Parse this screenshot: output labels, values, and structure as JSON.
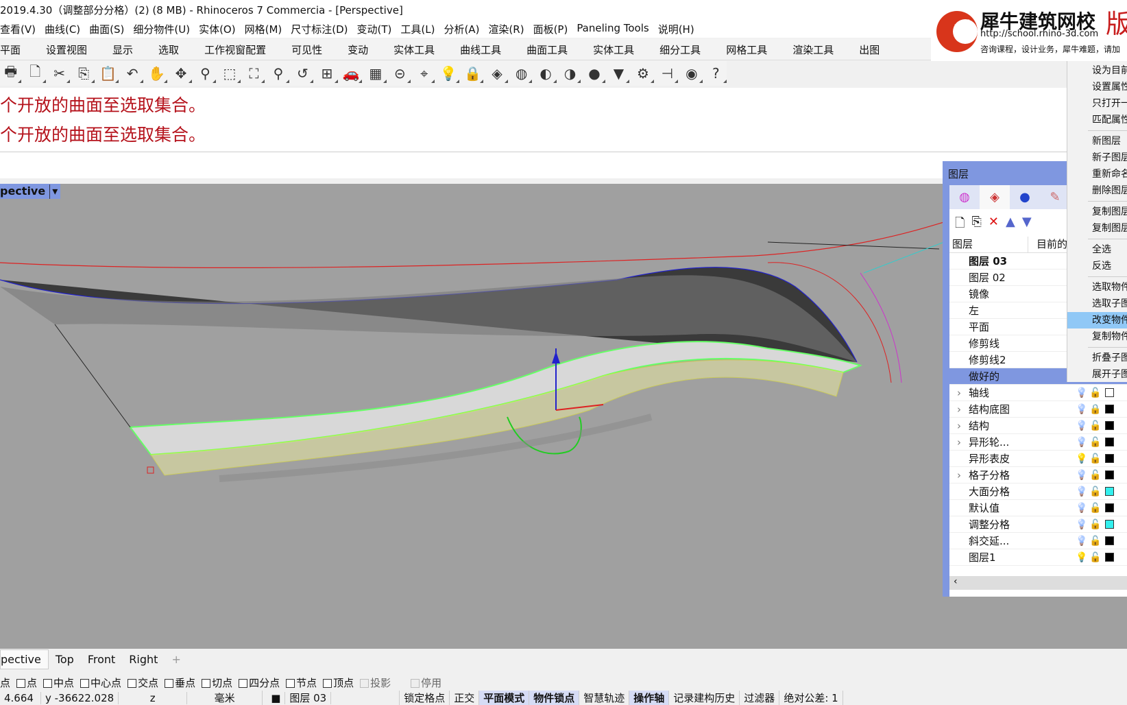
{
  "title": "2019.4.30（调整部分分格）(2) (8 MB) - Rhinoceros 7 Commercia - [Perspective]",
  "menu": [
    "查看(V)",
    "曲线(C)",
    "曲面(S)",
    "细分物件(U)",
    "实体(O)",
    "网格(M)",
    "尺寸标注(D)",
    "变动(T)",
    "工具(L)",
    "分析(A)",
    "渲染(R)",
    "面板(P)",
    "Paneling Tools",
    "说明(H)"
  ],
  "tabs": [
    "平面",
    "设置视图",
    "显示",
    "选取",
    "工作视窗配置",
    "可见性",
    "变动",
    "实体工具",
    "曲线工具",
    "曲面工具",
    "实体工具",
    "细分工具",
    "网格工具",
    "渲染工具",
    "出图"
  ],
  "toolbar": [
    {
      "icon": "print-icon",
      "g": "🖶"
    },
    {
      "icon": "new-file-icon",
      "g": "🗋"
    },
    {
      "icon": "cut-icon",
      "g": "✂"
    },
    {
      "icon": "copy-icon",
      "g": "⎘"
    },
    {
      "icon": "paste-icon",
      "g": "📋"
    },
    {
      "icon": "undo-icon",
      "g": "↶"
    },
    {
      "icon": "pan-hand-icon",
      "g": "✋"
    },
    {
      "icon": "rotate-view-icon",
      "g": "✥"
    },
    {
      "icon": "zoom-icon",
      "g": "⚲"
    },
    {
      "icon": "zoom-window-icon",
      "g": "⬚"
    },
    {
      "icon": "zoom-extents-icon",
      "g": "⛶"
    },
    {
      "icon": "zoom-selected-icon",
      "g": "⚲"
    },
    {
      "icon": "undo-view-icon",
      "g": "↺"
    },
    {
      "icon": "four-viewports-icon",
      "g": "⊞"
    },
    {
      "icon": "car-icon",
      "g": "🚗"
    },
    {
      "icon": "grid-icon",
      "g": "▦"
    },
    {
      "icon": "snap-icon",
      "g": "⊝"
    },
    {
      "icon": "gumball-icon",
      "g": "⌖"
    },
    {
      "icon": "light-bulb-icon",
      "g": "💡"
    },
    {
      "icon": "lock-icon",
      "g": "🔒"
    },
    {
      "icon": "layer-icon",
      "g": "◈"
    },
    {
      "icon": "color-wheel-icon",
      "g": "◍"
    },
    {
      "icon": "shaded-sphere-icon",
      "g": "◐"
    },
    {
      "icon": "wire-sphere-icon",
      "g": "◑"
    },
    {
      "icon": "render-sphere-icon",
      "g": "●"
    },
    {
      "icon": "cone-icon",
      "g": "▼"
    },
    {
      "icon": "gear-icon",
      "g": "⚙"
    },
    {
      "icon": "dimension-icon",
      "g": "⊣"
    },
    {
      "icon": "globe-icon",
      "g": "◉"
    },
    {
      "icon": "help-icon",
      "g": "?"
    }
  ],
  "history": [
    "个开放的曲面至选取集合。",
    "个开放的曲面至选取集合。"
  ],
  "viewport": {
    "label": "pective"
  },
  "viewport_tabs": [
    "pective",
    "Top",
    "Front",
    "Right",
    "+"
  ],
  "osnap": {
    "lead": "点",
    "items": [
      {
        "label": "点",
        "on": false
      },
      {
        "label": "中点",
        "on": false
      },
      {
        "label": "中心点",
        "on": false
      },
      {
        "label": "交点",
        "on": false
      },
      {
        "label": "垂点",
        "on": false
      },
      {
        "label": "切点",
        "on": false
      },
      {
        "label": "四分点",
        "on": false
      },
      {
        "label": "节点",
        "on": false
      },
      {
        "label": "顶点",
        "on": false
      }
    ],
    "project": "投影",
    "disable": "停用"
  },
  "status": {
    "x": "4.664",
    "y": "y -36622.028",
    "z": "z",
    "unit": "毫米",
    "layer": "图层 03",
    "buttons": [
      {
        "label": "锁定格点",
        "on": false
      },
      {
        "label": "正交",
        "on": false
      },
      {
        "label": "平面模式",
        "on": true
      },
      {
        "label": "物件锁点",
        "on": true
      },
      {
        "label": "智慧轨迹",
        "on": false
      },
      {
        "label": "操作轴",
        "on": true
      },
      {
        "label": "记录建构历史",
        "on": false
      },
      {
        "label": "过滤器",
        "on": false
      },
      {
        "label": "绝对公差: 1",
        "on": false
      }
    ]
  },
  "logo": {
    "name": "犀牛建筑网校",
    "url": "http://school.rhino-3d.com",
    "tag": "版",
    "slogan": "咨询课程，设计业务，犀牛难题，请加"
  },
  "layers": {
    "title": "图层",
    "col_layer": "图层",
    "col_current": "目前的",
    "rows": [
      {
        "name": "图层 03",
        "current": true
      },
      {
        "name": "图层 02"
      },
      {
        "name": "镜像"
      },
      {
        "name": "左"
      },
      {
        "name": "平面"
      },
      {
        "name": "修剪线"
      },
      {
        "name": "修剪线2"
      },
      {
        "name": "做好的",
        "selected": true
      },
      {
        "name": "轴线",
        "expand": true,
        "bulb": "#6f95cf",
        "lock": "open",
        "color": "#ffffff"
      },
      {
        "name": "结构底图",
        "expand": true,
        "bulb": "#6f95cf",
        "lock": "locked",
        "color": "#000000"
      },
      {
        "name": "结构",
        "expand": true,
        "bulb": "#6f95cf",
        "lock": "open",
        "color": "#000000"
      },
      {
        "name": "异形轮...",
        "expand": true,
        "bulb": "#6f95cf",
        "lock": "open",
        "color": "#000000"
      },
      {
        "name": "异形表皮",
        "bulb": "#f2e06a",
        "lock": "open",
        "color": "#000000"
      },
      {
        "name": "格子分格",
        "expand": true,
        "bulb": "#6f95cf",
        "lock": "open",
        "color": "#000000"
      },
      {
        "name": "大面分格",
        "bulb": "#6f95cf",
        "lock": "open",
        "color": "#33f0ee"
      },
      {
        "name": "默认值",
        "bulb": "#6f95cf",
        "lock": "open",
        "color": "#000000"
      },
      {
        "name": "调整分格",
        "bulb": "#6f95cf",
        "lock": "open",
        "color": "#33f0ee"
      },
      {
        "name": "斜交延...",
        "bulb": "#6f95cf",
        "lock": "open",
        "color": "#000000"
      },
      {
        "name": "图层1",
        "bulb": "#f2e06a",
        "lock": "open",
        "color": "#000000"
      }
    ]
  },
  "context_menu": [
    [
      "设为目前",
      "设置属性",
      "只打开一",
      "匹配属性"
    ],
    [
      "新图层",
      "新子图层",
      "重新命名",
      "删除图层"
    ],
    [
      "复制图层",
      "复制图层"
    ],
    [
      "全选",
      "反选"
    ],
    [
      "选取物件",
      "选取子图",
      "改变物件",
      "复制物件"
    ],
    [
      "折叠子图",
      "展开子图"
    ]
  ],
  "context_highlight": "改变物件",
  "colors": {
    "accent": "#7f97e0",
    "command_text": "#b5121b",
    "viewport_bg": "#a0a0a0"
  }
}
